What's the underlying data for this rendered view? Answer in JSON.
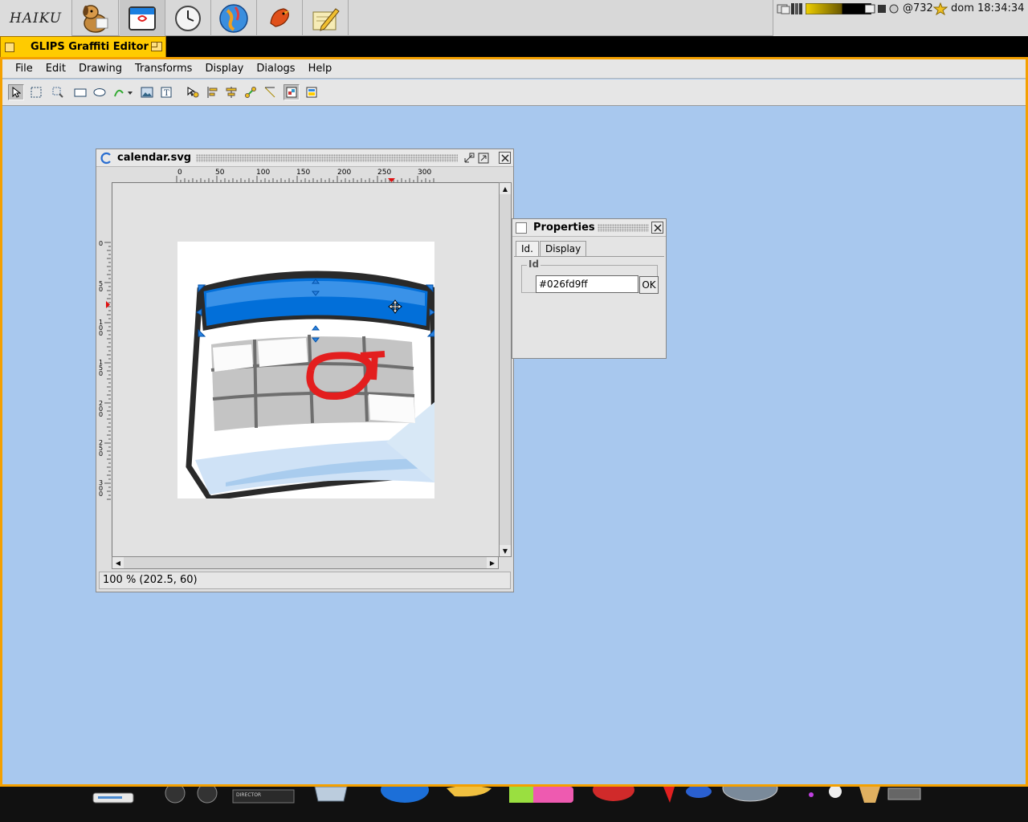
{
  "deskbar": {
    "logo": "HAIKU",
    "apps": [
      {
        "name": "tracker-app",
        "icon": "dog-icon"
      },
      {
        "name": "calendar-app",
        "icon": "calendar-icon"
      },
      {
        "name": "clock-app",
        "icon": "clock-icon"
      },
      {
        "name": "network-app",
        "icon": "globe-icon"
      },
      {
        "name": "bird-app",
        "icon": "bird-icon"
      },
      {
        "name": "editor-app",
        "icon": "pencil-icon"
      }
    ],
    "tray": {
      "count": "@732",
      "clock": "dom 18:34:34"
    }
  },
  "main_window": {
    "title": "GLIPS Graffiti Editor",
    "menu": [
      "File",
      "Edit",
      "Drawing",
      "Transforms",
      "Display",
      "Dialogs",
      "Help"
    ],
    "tools": [
      "select-arrow-icon",
      "marquee-icon",
      "zoom-icon",
      "rectangle-icon",
      "ellipse-icon",
      "path-icon",
      "image-icon",
      "text-icon",
      "node-icon",
      "align-icon",
      "distribute-icon",
      "transform-icon",
      "line-icon",
      "view-icon",
      "color-icon"
    ]
  },
  "document_window": {
    "title": "calendar.svg",
    "ruler_top": [
      "0",
      "50",
      "100",
      "150",
      "200",
      "250",
      "300"
    ],
    "ruler_left": [
      "0",
      "5\n0",
      "1\n0\n0",
      "1\n5\n0",
      "2\n0\n0",
      "2\n5\n0",
      "3\n0\n0"
    ],
    "status": "100 %  (202.5, 60)",
    "colors": {
      "header_blue": "#026fd9",
      "header_light": "#3a92e8",
      "frame": "#2a2a2a",
      "grid": "#9c9c9c",
      "mark": "#e31e1e"
    }
  },
  "properties": {
    "title": "Properties",
    "tabs": [
      "Id.",
      "Display"
    ],
    "group_label": "Id",
    "id_value": "#026fd9ff",
    "ok_label": "OK"
  }
}
